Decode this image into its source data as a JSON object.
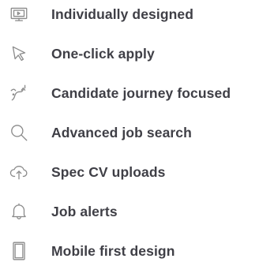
{
  "colors": {
    "icon": "#8a8a8a",
    "text": "#3f3f46",
    "background": "#ffffff"
  },
  "features": [
    {
      "icon": "monitor-icon",
      "label": "Individually designed"
    },
    {
      "icon": "cursor-icon",
      "label": "One-click apply"
    },
    {
      "icon": "journey-icon",
      "label": "Candidate journey focused"
    },
    {
      "icon": "search-icon",
      "label": "Advanced job search"
    },
    {
      "icon": "cloud-upload-icon",
      "label": "Spec CV uploads"
    },
    {
      "icon": "bell-icon",
      "label": "Job alerts"
    },
    {
      "icon": "mobile-icon",
      "label": "Mobile first design"
    }
  ]
}
